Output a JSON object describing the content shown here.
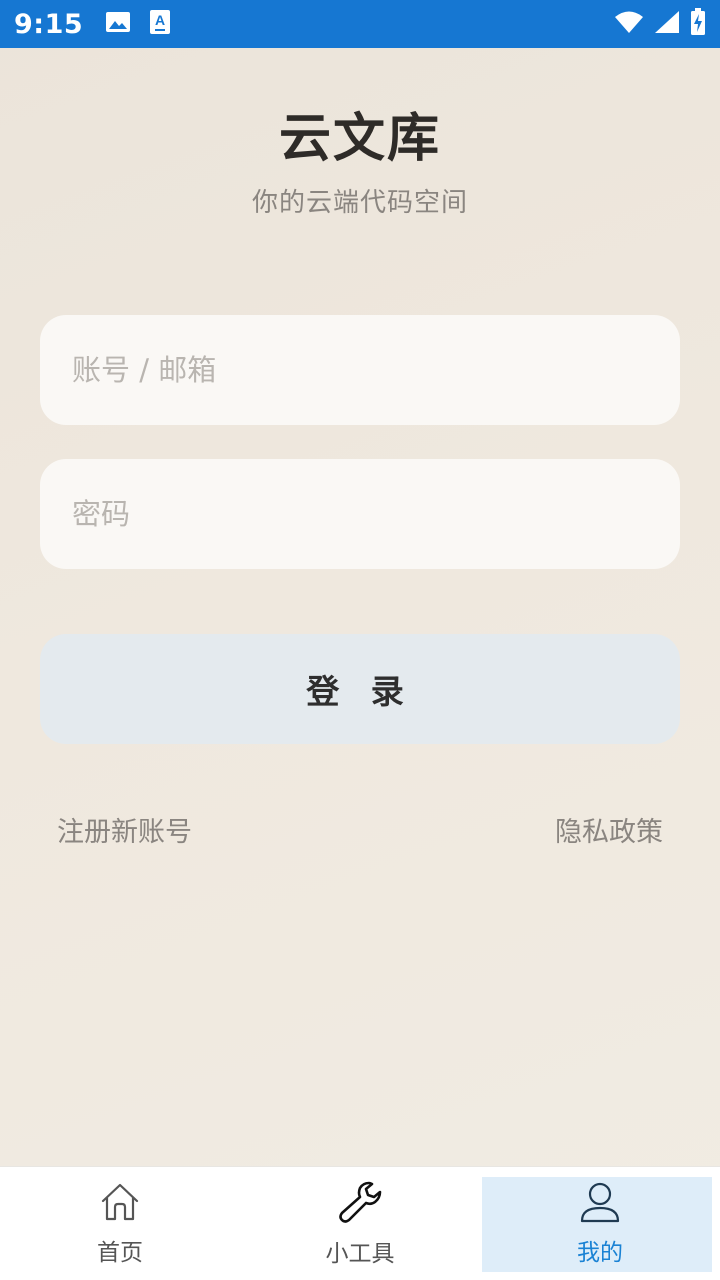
{
  "status_bar": {
    "time": "9:15",
    "icons_left": [
      "image-icon",
      "font-a-icon"
    ],
    "icons_right": [
      "wifi-icon",
      "signal-icon",
      "battery-charging-icon"
    ],
    "background_color": "#1677d2"
  },
  "header": {
    "title": "云文库",
    "subtitle": "你的云端代码空间"
  },
  "form": {
    "account_placeholder": "账号 / 邮箱",
    "account_value": "",
    "password_placeholder": "密码",
    "password_value": "",
    "login_label": "登 录"
  },
  "links": {
    "register": "注册新账号",
    "privacy": "隐私政策"
  },
  "bottom_nav": {
    "items": [
      {
        "label": "首页",
        "icon": "home-icon",
        "active": false
      },
      {
        "label": "小工具",
        "icon": "wrench-icon",
        "active": false
      },
      {
        "label": "我的",
        "icon": "user-icon",
        "active": true
      }
    ],
    "active_color": "#1a82d4",
    "active_background": "#deedf9"
  }
}
